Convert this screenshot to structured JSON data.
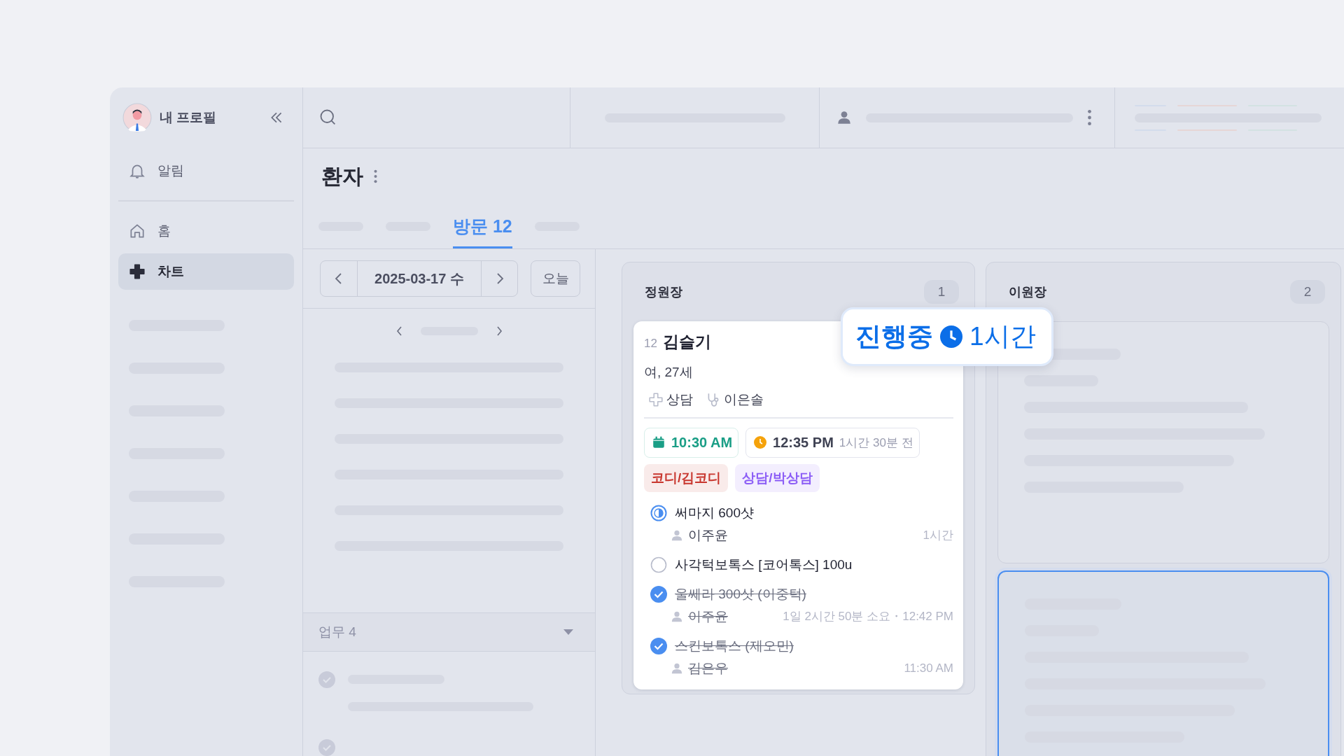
{
  "sidebar": {
    "profile": {
      "label": "내 프로필"
    },
    "items": [
      {
        "label": "알림",
        "selected": false
      },
      {
        "label": "홈",
        "selected": false
      },
      {
        "label": "차트",
        "selected": true
      }
    ]
  },
  "header": {
    "title": "환자"
  },
  "tabs": [
    {
      "label": "방문 12",
      "selected": true
    }
  ],
  "date_nav": {
    "date": "2025-03-17 수",
    "today_button": "오늘"
  },
  "tasks": {
    "label": "업무 4"
  },
  "columns": [
    {
      "name": "정원장",
      "count": "1",
      "card": {
        "number": "12",
        "name": "김슬기",
        "info": "여, 27세",
        "category": "상담",
        "doctor": "이은솔",
        "reserved_time": "10:30 AM",
        "arrival_time": "12:35 PM",
        "arrival_ago": "1시간 30분 전",
        "tags": [
          {
            "label": "코디/김코디",
            "color": "#c8372f"
          },
          {
            "label": "상담/박상담",
            "color": "#8b5cf6"
          }
        ],
        "procedures": [
          {
            "title": "써마지 600샷",
            "kind": "in_progress",
            "staff": "이주윤",
            "meta": "1시간"
          },
          {
            "title": "사각턱보톡스 [코어톡스] 100u",
            "kind": "pending"
          },
          {
            "title": "울쎄라 300샷 (이중턱)",
            "kind": "done",
            "staff": "이주윤",
            "meta": "1일 2시간 50분 소요・12:42 PM"
          },
          {
            "title": "스킨보톡스 (제오민)",
            "kind": "done",
            "staff": "김은우",
            "meta": "11:30 AM"
          }
        ],
        "status_badge": {
          "label": "진행중",
          "duration": "1시간"
        }
      }
    },
    {
      "name": "이원장",
      "count": "2",
      "placeholder_cards": [
        {
          "selected": false
        },
        {
          "selected": true
        }
      ]
    }
  ]
}
